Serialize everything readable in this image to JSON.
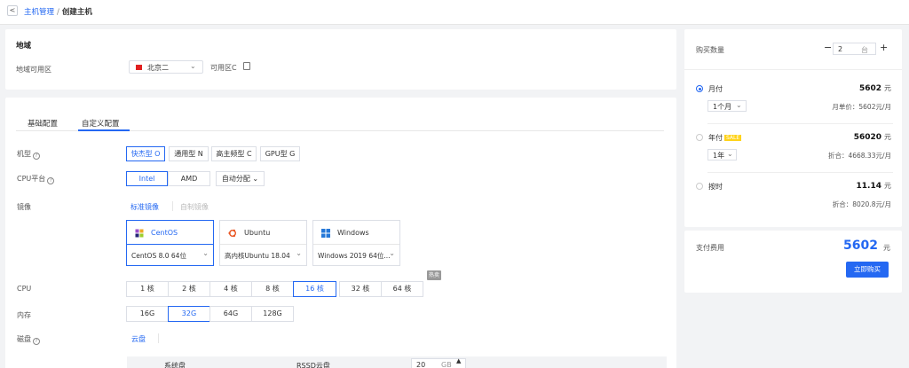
{
  "breadcrumb": {
    "back": "<",
    "parent": "主机管理",
    "sep": "/",
    "current": "创建主机"
  },
  "region": {
    "title": "地域",
    "label": "地域可用区",
    "selected": "北京二",
    "zone": "可用区C"
  },
  "tabs": [
    "基础配置",
    "自定义配置"
  ],
  "model": {
    "label": "机型",
    "options": [
      "快杰型 O",
      "通用型 N",
      "高主频型 C",
      "GPU型 G"
    ],
    "selected": 0
  },
  "cpu_platform": {
    "label": "CPU平台",
    "options": [
      "Intel",
      "AMD"
    ],
    "auto": "自动分配"
  },
  "image": {
    "label": "镜像",
    "tabs": [
      "标准镜像",
      "自制镜像"
    ],
    "os": [
      {
        "name": "CentOS",
        "version": "CentOS 8.0 64位"
      },
      {
        "name": "Ubuntu",
        "version": "高内核Ubuntu 18.04"
      },
      {
        "name": "Windows",
        "version": "Windows 2019 64位..."
      }
    ]
  },
  "cpu": {
    "label": "CPU",
    "options": [
      "1 核",
      "2 核",
      "4 核",
      "8 核",
      "16 核",
      "32 核",
      "64 核"
    ],
    "selected": 4,
    "tooltip": "热卖"
  },
  "memory": {
    "label": "内存",
    "options": [
      "16G",
      "32G",
      "64G",
      "128G"
    ],
    "selected": 1
  },
  "disk": {
    "label": "磁盘",
    "tab": "云盘",
    "col1": "系统盘",
    "col2": "RSSD云盘",
    "size": "20",
    "unit": "GB"
  },
  "order": {
    "qty_label": "购买数量",
    "qty": "2",
    "qty_unit": "台",
    "minus": "−",
    "plus": "+",
    "plans": [
      {
        "name": "月付",
        "price": "5602",
        "unit": "元",
        "period": "1个月",
        "sub": "月单价：5602元/月"
      },
      {
        "name": "年付",
        "badge": "SALE",
        "price": "56020",
        "unit": "元",
        "period": "1年",
        "sub": "折合：4668.33元/月"
      },
      {
        "name": "按时",
        "price": "11.14",
        "unit": "元",
        "sub": "折合：8020.8元/月"
      }
    ]
  },
  "pay": {
    "label": "支付费用",
    "total": "5602",
    "unit": "元",
    "button": "立即购买"
  },
  "colors": {
    "accent": "#2468f2",
    "sale": "#ffd31a",
    "flag": "#e02020"
  }
}
